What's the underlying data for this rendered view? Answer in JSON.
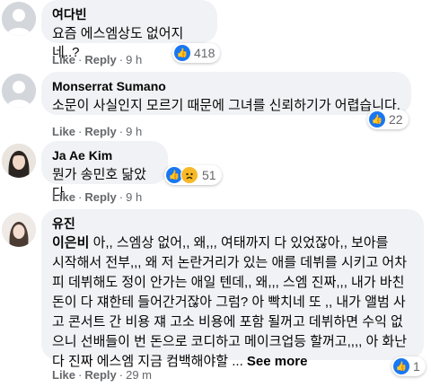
{
  "comments": [
    {
      "name": "여다빈",
      "text": "요즘 에스엠상도 없어지네..?",
      "like_label": "Like",
      "reply_label": "Reply",
      "time": "9 h",
      "reaction_count": "418",
      "reaction_icons": [
        "like-icon"
      ]
    },
    {
      "name": "Monserrat Sumano",
      "text": "소문이 사실인지 모르기 때문에 그녀를 신뢰하기가 어렵습니다.",
      "like_label": "Like",
      "reply_label": "Reply",
      "time": "9 h",
      "reaction_count": "22",
      "reaction_icons": [
        "like-icon"
      ]
    },
    {
      "name": "Ja Ae Kim",
      "text": "뭔가 송민호 닮았다",
      "like_label": "Like",
      "reply_label": "Reply",
      "time": "9 h",
      "reaction_count": "51",
      "reaction_icons": [
        "like-icon",
        "sad-icon"
      ]
    },
    {
      "name": "유진",
      "mention": "이은비",
      "lines": [
        " 아,, 스엠상 없어,, 왜,,, 여태까지 다 있었잖아,, 보아를",
        "시작해서 전부,,, 왜 저 논란거리가 있는 애를 데뷔를 시키고 어차",
        "피 데뷔해도 정이 안가는 애일 텐데,, 왜,,, 스엠 진짜,,, 내가 바친",
        "돈이 다 쟤한테 들어간거잖아 그럼? 아 빡치네 또 ,, 내가 앨범 사",
        "고 콘서트 간 비용 쟤 고소 비용에 포함 될꺼고 데뷔하면 수익 없",
        "으니 선배들이 번 돈으로 코디하고 메이크업등 할꺼고,,,, 아 화난",
        "다 진짜 에스엠 지금 컴백해야할 ... "
      ],
      "see_more": "See more",
      "like_label": "Like",
      "reply_label": "Reply",
      "time": "29 m",
      "reaction_count": "1",
      "reaction_icons": [
        "like-icon"
      ]
    }
  ],
  "colors": {
    "bubble": "#f0f2f5",
    "meta": "#65676b",
    "like_blue": "#1877f2",
    "sad_yellow": "#f7b928"
  }
}
